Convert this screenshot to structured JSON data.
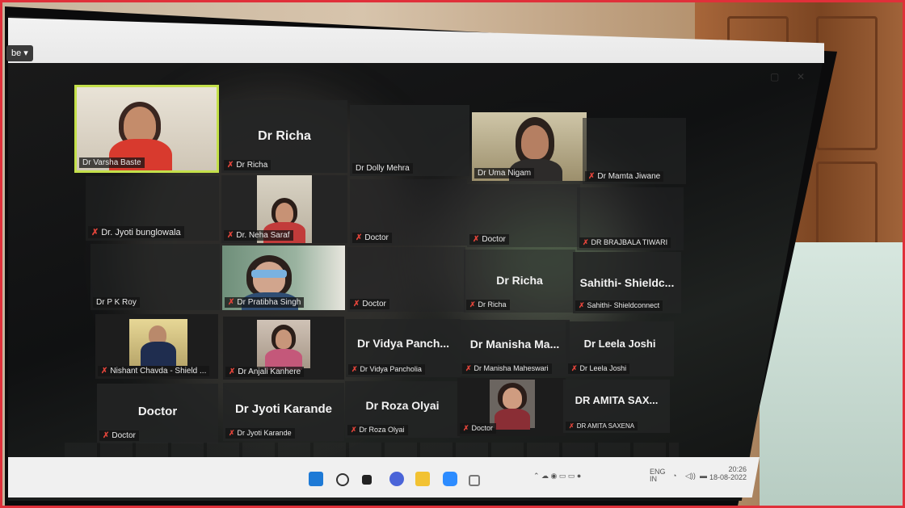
{
  "top_left": {
    "view_button": "be ▾"
  },
  "window_controls": {
    "restore": "▢",
    "close": "✕"
  },
  "tiles": [
    {
      "id": "t1",
      "big": "",
      "tag": "Dr Varsha Baste",
      "muted": false
    },
    {
      "id": "t2",
      "big": "Dr Richa",
      "tag": "Dr Richa",
      "muted": true
    },
    {
      "id": "t3",
      "big": "",
      "tag": "Dr Dolly Mehra",
      "muted": false
    },
    {
      "id": "t4",
      "big": "",
      "tag": "Dr Uma Nigam",
      "muted": false
    },
    {
      "id": "t5",
      "big": "",
      "tag": "Dr Mamta Jiwane",
      "muted": true
    },
    {
      "id": "t6",
      "big": "",
      "tag": "Dr. Jyoti bunglowala",
      "muted": true
    },
    {
      "id": "t7",
      "big": "",
      "tag": "Dr. Neha Saraf",
      "muted": true
    },
    {
      "id": "t8",
      "big": "",
      "tag": "Doctor",
      "muted": true
    },
    {
      "id": "t9",
      "big": "",
      "tag": "Doctor",
      "muted": true
    },
    {
      "id": "t10",
      "big": "",
      "tag": "DR BRAJBALA TIWARI",
      "muted": true
    },
    {
      "id": "t11",
      "big": "",
      "tag": "Dr P K Roy",
      "muted": false
    },
    {
      "id": "t12",
      "big": "",
      "tag": "Dr Pratibha Singh",
      "muted": true
    },
    {
      "id": "t13",
      "big": "",
      "tag": "Doctor",
      "muted": true
    },
    {
      "id": "t14",
      "big": "Dr Richa",
      "tag": "Dr Richa",
      "muted": true
    },
    {
      "id": "t15",
      "big": "Sahithi- Shieldc...",
      "tag": "Sahithi- Shieldconnect",
      "muted": true
    },
    {
      "id": "t16",
      "big": "",
      "tag": "Nishant Chavda - Shield ...",
      "muted": true
    },
    {
      "id": "t17",
      "big": "",
      "tag": "Dr Anjali Kanhere",
      "muted": true
    },
    {
      "id": "t18",
      "big": "Dr Vidya Panch...",
      "tag": "Dr Vidya Pancholia",
      "muted": true
    },
    {
      "id": "t19",
      "big": "Dr Manisha Ma...",
      "tag": "Dr Manisha Maheswari",
      "muted": true
    },
    {
      "id": "t20",
      "big": "Dr Leela Joshi",
      "tag": "Dr Leela Joshi",
      "muted": true
    },
    {
      "id": "t21",
      "big": "Doctor",
      "tag": "Doctor",
      "muted": true
    },
    {
      "id": "t22",
      "big": "Dr Jyoti Karande",
      "tag": "Dr Jyoti Karande",
      "muted": true
    },
    {
      "id": "t23",
      "big": "Dr Roza Olyai",
      "tag": "Dr Roza Olyai",
      "muted": true
    },
    {
      "id": "t24",
      "big": "",
      "tag": "Doctor",
      "muted": true
    },
    {
      "id": "t25",
      "big": "DR AMITA SAX...",
      "tag": "DR AMITA SAXENA",
      "muted": true
    }
  ],
  "mic_icon": "✗",
  "tray": {
    "lang": "ENG",
    "region": "IN",
    "time": "20:26",
    "date": "18-08-2022"
  },
  "colors": {
    "active_border": "#c4e04a",
    "muted_mic": "#e0443a",
    "start": "#1e7ad6"
  }
}
